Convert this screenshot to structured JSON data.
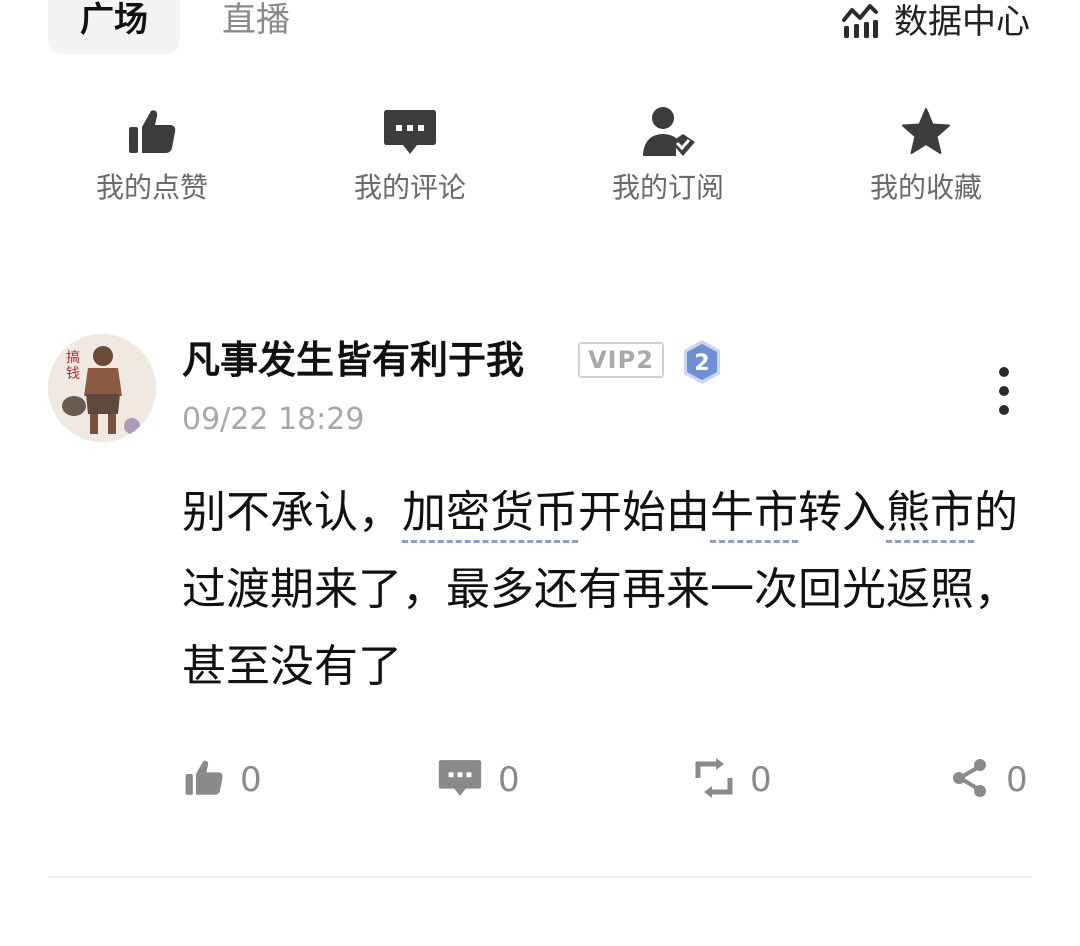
{
  "tabs": {
    "active": "广场",
    "other": "直播",
    "data_center": "数据中心",
    "data_center_icon": "chart-icon"
  },
  "shortcuts": [
    {
      "label": "我的点赞",
      "icon": "thumbs-up-icon"
    },
    {
      "label": "我的评论",
      "icon": "comment-icon"
    },
    {
      "label": "我的订阅",
      "icon": "subscribe-user-icon"
    },
    {
      "label": "我的收藏",
      "icon": "star-icon"
    }
  ],
  "post": {
    "username": "凡事发生皆有利于我",
    "vip": "VIP2",
    "level": "2",
    "timestamp": "09/22 18:29",
    "content": {
      "p1": "别不承认，",
      "t1": "加密货币",
      "p2": "开始由",
      "t2": "牛市",
      "p3": "转入",
      "t3": "熊市",
      "p4": "的过渡期来了，最多还有再来一次回光返照，甚至没有了"
    },
    "actions": {
      "likes": "0",
      "comments": "0",
      "reposts": "0",
      "shares": "0"
    }
  },
  "colors": {
    "text_primary": "#111111",
    "text_secondary": "#6a6a6a",
    "icon": "#3c3c3c",
    "tag_underline": "#8aa0c8",
    "level_badge": "#6f8fd6"
  }
}
